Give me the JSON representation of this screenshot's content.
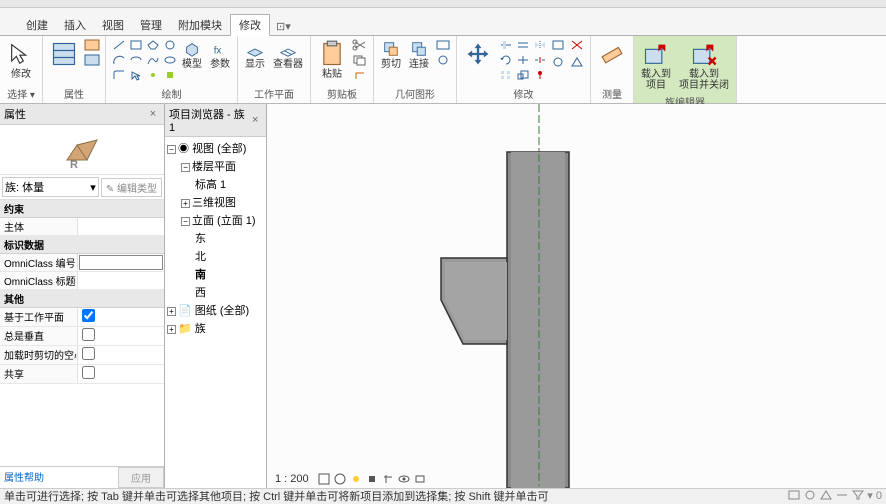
{
  "tabs": {
    "t0": "创建",
    "t1": "插入",
    "t2": "视图",
    "t3": "管理",
    "t4": "附加模块",
    "t5": "修改",
    "extra": "⊡▾"
  },
  "ribbon": {
    "modify": "修改",
    "select": "选择 ▾",
    "props": "属性",
    "p_props": "属性",
    "p_clip": "剪贴板",
    "p_draw": "绘制",
    "p_work": "工作平面",
    "p_cut": "剪贴板",
    "p_geom": "几何图形",
    "p_mod": "修改",
    "p_meas": "测量",
    "p_famed": "族编辑器",
    "model": "模型",
    "param": "参数",
    "show": "显示",
    "viewer": "查看器",
    "paste": "粘贴",
    "cut": "剪切",
    "join": "连接",
    "load": "载入到\n项目",
    "loadclose": "载入到\n项目并关闭"
  },
  "propPanel": {
    "title": "属性",
    "family": "族: 体量",
    "editType": "✎ 编辑类型",
    "s_constraint": "约束",
    "s_id": "标识数据",
    "s_other": "其他",
    "r_host": "主体",
    "r_omni_num": "OmniClass 编号",
    "r_omni_title": "OmniClass 标题",
    "r_workplane": "基于工作平面",
    "r_vertical": "总是垂直",
    "r_cutvoid": "加载时剪切的空心",
    "r_shared": "共享",
    "help": "属性帮助",
    "apply": "应用"
  },
  "browser": {
    "title": "项目浏览器 - 族1",
    "views": "视图 (全部)",
    "floorplans": "楼层平面",
    "level1": "标高 1",
    "threed": "三维视图",
    "elev": "立面 (立面 1)",
    "east": "东",
    "north": "北",
    "south": "南",
    "west": "西",
    "sheets": "图纸 (全部)",
    "families": "族"
  },
  "viewbar": {
    "scale": "1 : 200"
  },
  "status": {
    "hint": "单击可进行选择; 按 Tab 键并单击可选择其他项目; 按 Ctrl 键并单击可将新项目添加到选择集; 按 Shift 键并单击可"
  }
}
